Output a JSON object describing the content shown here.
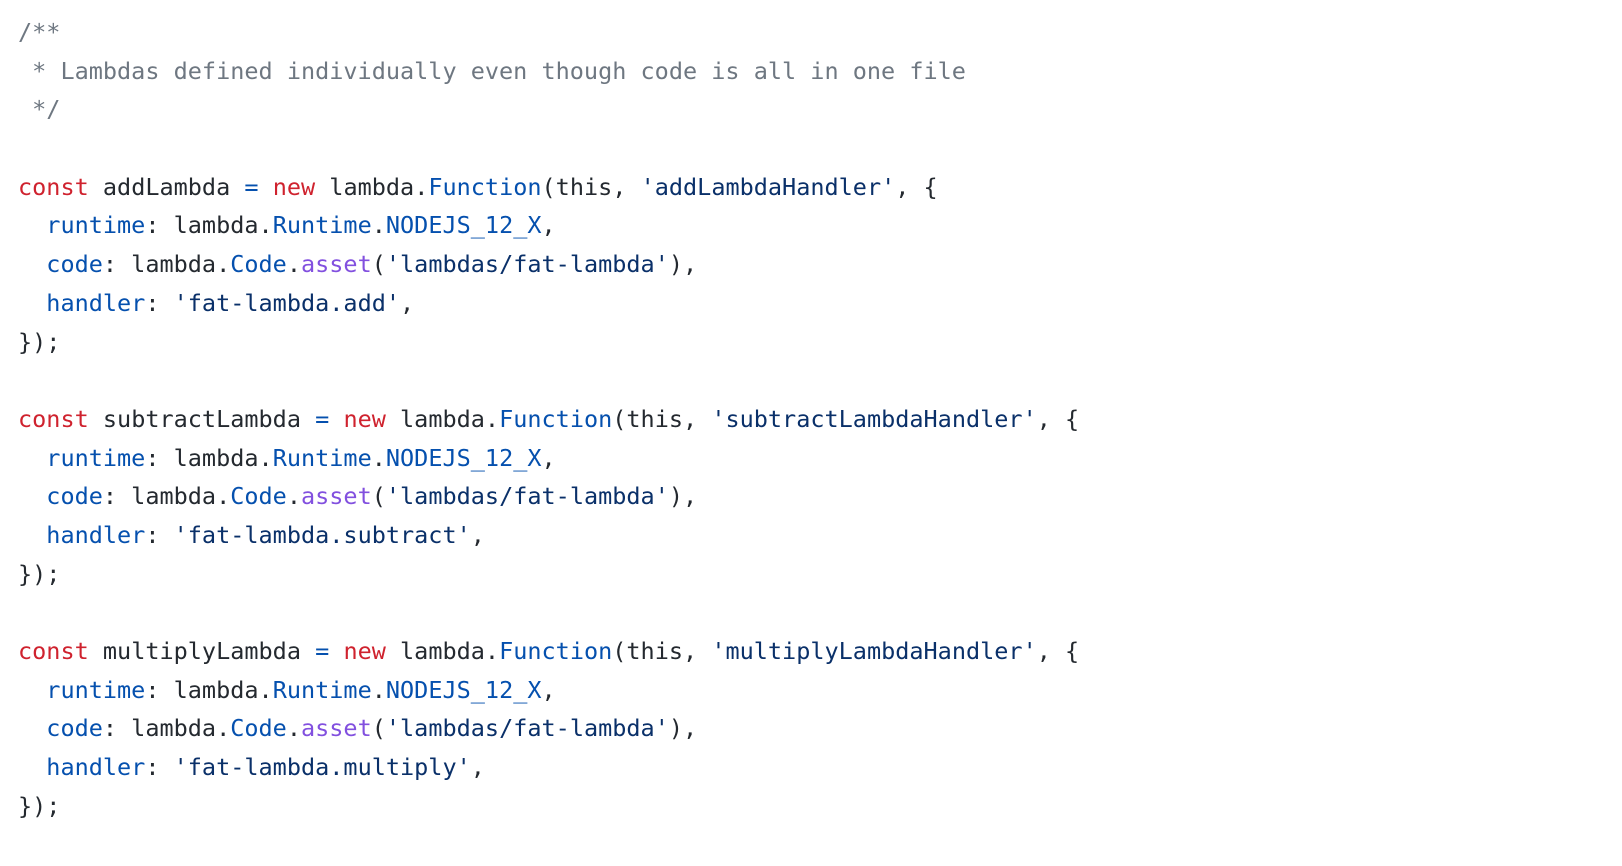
{
  "code": {
    "lines": [
      [
        {
          "t": "/**",
          "k": "comment"
        }
      ],
      [
        {
          "t": " * Lambdas defined individually even though code is all in one file",
          "k": "comment"
        }
      ],
      [
        {
          "t": " */",
          "k": "comment"
        }
      ],
      [],
      [
        {
          "t": "const",
          "k": "keyword"
        },
        {
          "t": " addLambda ",
          "k": "plain"
        },
        {
          "t": "=",
          "k": "operator"
        },
        {
          "t": " ",
          "k": "plain"
        },
        {
          "t": "new",
          "k": "keyword"
        },
        {
          "t": " lambda.",
          "k": "plain"
        },
        {
          "t": "Function",
          "k": "class"
        },
        {
          "t": "(this, ",
          "k": "plain"
        },
        {
          "t": "'addLambdaHandler'",
          "k": "string"
        },
        {
          "t": ", {",
          "k": "plain"
        }
      ],
      [
        {
          "t": "  ",
          "k": "plain"
        },
        {
          "t": "runtime",
          "k": "prop"
        },
        {
          "t": ": lambda.",
          "k": "plain"
        },
        {
          "t": "Runtime",
          "k": "class"
        },
        {
          "t": ".",
          "k": "plain"
        },
        {
          "t": "NODEJS_12_X",
          "k": "prop"
        },
        {
          "t": ",",
          "k": "plain"
        }
      ],
      [
        {
          "t": "  ",
          "k": "plain"
        },
        {
          "t": "code",
          "k": "prop"
        },
        {
          "t": ": lambda.",
          "k": "plain"
        },
        {
          "t": "Code",
          "k": "class"
        },
        {
          "t": ".",
          "k": "plain"
        },
        {
          "t": "asset",
          "k": "method"
        },
        {
          "t": "(",
          "k": "plain"
        },
        {
          "t": "'lambdas/fat-lambda'",
          "k": "string"
        },
        {
          "t": "),",
          "k": "plain"
        }
      ],
      [
        {
          "t": "  ",
          "k": "plain"
        },
        {
          "t": "handler",
          "k": "prop"
        },
        {
          "t": ": ",
          "k": "plain"
        },
        {
          "t": "'fat-lambda.add'",
          "k": "string"
        },
        {
          "t": ",",
          "k": "plain"
        }
      ],
      [
        {
          "t": "});",
          "k": "plain"
        }
      ],
      [],
      [
        {
          "t": "const",
          "k": "keyword"
        },
        {
          "t": " subtractLambda ",
          "k": "plain"
        },
        {
          "t": "=",
          "k": "operator"
        },
        {
          "t": " ",
          "k": "plain"
        },
        {
          "t": "new",
          "k": "keyword"
        },
        {
          "t": " lambda.",
          "k": "plain"
        },
        {
          "t": "Function",
          "k": "class"
        },
        {
          "t": "(this, ",
          "k": "plain"
        },
        {
          "t": "'subtractLambdaHandler'",
          "k": "string"
        },
        {
          "t": ", {",
          "k": "plain"
        }
      ],
      [
        {
          "t": "  ",
          "k": "plain"
        },
        {
          "t": "runtime",
          "k": "prop"
        },
        {
          "t": ": lambda.",
          "k": "plain"
        },
        {
          "t": "Runtime",
          "k": "class"
        },
        {
          "t": ".",
          "k": "plain"
        },
        {
          "t": "NODEJS_12_X",
          "k": "prop"
        },
        {
          "t": ",",
          "k": "plain"
        }
      ],
      [
        {
          "t": "  ",
          "k": "plain"
        },
        {
          "t": "code",
          "k": "prop"
        },
        {
          "t": ": lambda.",
          "k": "plain"
        },
        {
          "t": "Code",
          "k": "class"
        },
        {
          "t": ".",
          "k": "plain"
        },
        {
          "t": "asset",
          "k": "method"
        },
        {
          "t": "(",
          "k": "plain"
        },
        {
          "t": "'lambdas/fat-lambda'",
          "k": "string"
        },
        {
          "t": "),",
          "k": "plain"
        }
      ],
      [
        {
          "t": "  ",
          "k": "plain"
        },
        {
          "t": "handler",
          "k": "prop"
        },
        {
          "t": ": ",
          "k": "plain"
        },
        {
          "t": "'fat-lambda.subtract'",
          "k": "string"
        },
        {
          "t": ",",
          "k": "plain"
        }
      ],
      [
        {
          "t": "});",
          "k": "plain"
        }
      ],
      [],
      [
        {
          "t": "const",
          "k": "keyword"
        },
        {
          "t": " multiplyLambda ",
          "k": "plain"
        },
        {
          "t": "=",
          "k": "operator"
        },
        {
          "t": " ",
          "k": "plain"
        },
        {
          "t": "new",
          "k": "keyword"
        },
        {
          "t": " lambda.",
          "k": "plain"
        },
        {
          "t": "Function",
          "k": "class"
        },
        {
          "t": "(this, ",
          "k": "plain"
        },
        {
          "t": "'multiplyLambdaHandler'",
          "k": "string"
        },
        {
          "t": ", {",
          "k": "plain"
        }
      ],
      [
        {
          "t": "  ",
          "k": "plain"
        },
        {
          "t": "runtime",
          "k": "prop"
        },
        {
          "t": ": lambda.",
          "k": "plain"
        },
        {
          "t": "Runtime",
          "k": "class"
        },
        {
          "t": ".",
          "k": "plain"
        },
        {
          "t": "NODEJS_12_X",
          "k": "prop"
        },
        {
          "t": ",",
          "k": "plain"
        }
      ],
      [
        {
          "t": "  ",
          "k": "plain"
        },
        {
          "t": "code",
          "k": "prop"
        },
        {
          "t": ": lambda.",
          "k": "plain"
        },
        {
          "t": "Code",
          "k": "class"
        },
        {
          "t": ".",
          "k": "plain"
        },
        {
          "t": "asset",
          "k": "method"
        },
        {
          "t": "(",
          "k": "plain"
        },
        {
          "t": "'lambdas/fat-lambda'",
          "k": "string"
        },
        {
          "t": "),",
          "k": "plain"
        }
      ],
      [
        {
          "t": "  ",
          "k": "plain"
        },
        {
          "t": "handler",
          "k": "prop"
        },
        {
          "t": ": ",
          "k": "plain"
        },
        {
          "t": "'fat-lambda.multiply'",
          "k": "string"
        },
        {
          "t": ",",
          "k": "plain"
        }
      ],
      [
        {
          "t": "});",
          "k": "plain"
        }
      ]
    ]
  },
  "colors": {
    "background": "#ffffff",
    "comment": "#6e7781",
    "keyword": "#cf222e",
    "property": "#0550ae",
    "method": "#8250df",
    "string": "#0a3069",
    "text": "#24292f"
  }
}
